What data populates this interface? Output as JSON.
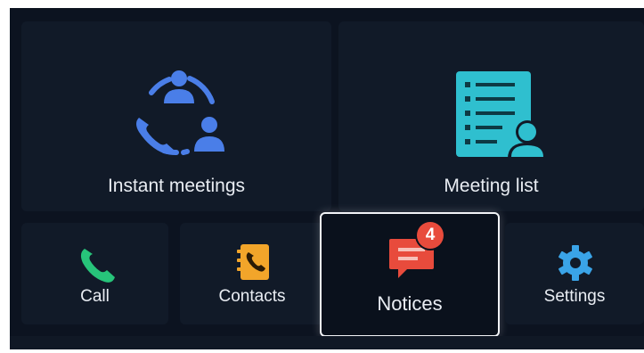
{
  "tiles": {
    "instant_meetings": {
      "label": "Instant meetings",
      "icon": "meeting-people-icon"
    },
    "meeting_list": {
      "label": "Meeting list",
      "icon": "meeting-list-icon"
    },
    "call": {
      "label": "Call",
      "icon": "phone-icon"
    },
    "contacts": {
      "label": "Contacts",
      "icon": "contacts-book-icon"
    },
    "notices": {
      "label": "Notices",
      "icon": "message-icon",
      "badge": "4"
    },
    "settings": {
      "label": "Settings",
      "icon": "gear-icon"
    }
  },
  "colors": {
    "background": "#0c1320",
    "tile": "#111a28",
    "blue_icon": "#4a7ee8",
    "teal_icon": "#2fbfcf",
    "green_icon": "#27c47a",
    "orange_icon": "#f2a52a",
    "red_icon": "#e84b3c",
    "settings_icon": "#3aa4e8"
  }
}
